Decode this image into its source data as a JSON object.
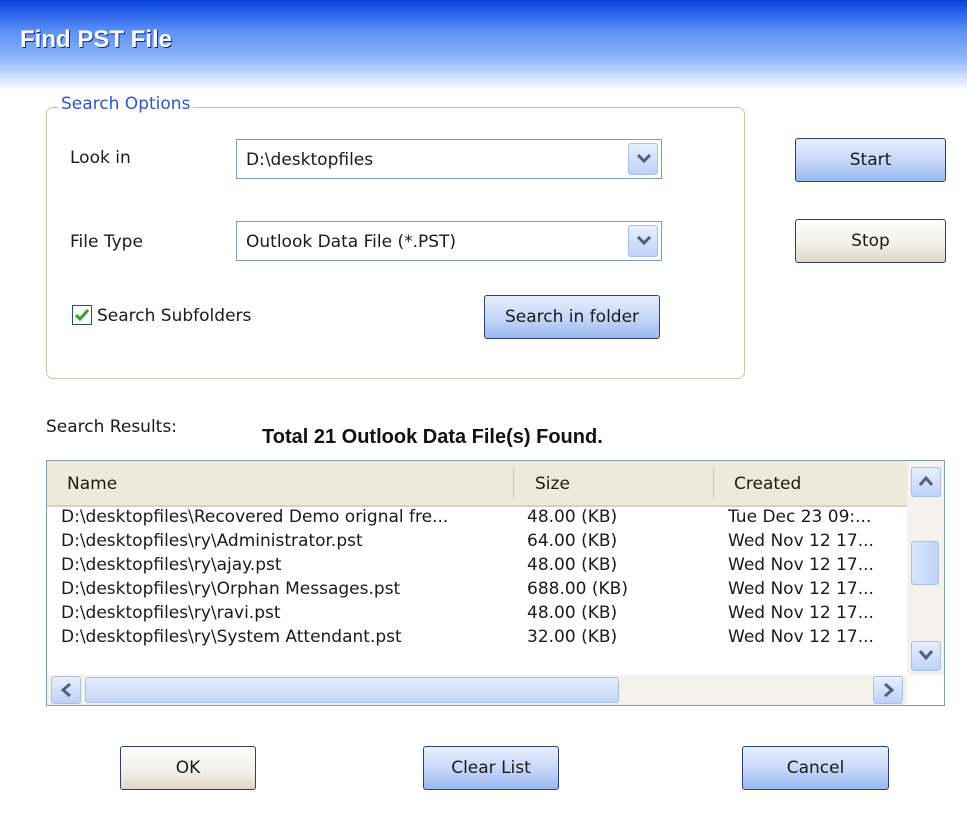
{
  "window": {
    "title": "Find PST File"
  },
  "search_options": {
    "legend": "Search Options",
    "look_in_label": "Look in",
    "look_in_value": "D:\\desktopfiles",
    "file_type_label": "File Type",
    "file_type_value": "Outlook Data File (*.PST)",
    "subfolders_label": "Search Subfolders",
    "subfolders_checked": true,
    "search_folder_button": "Search in folder"
  },
  "actions": {
    "start": "Start",
    "stop": "Stop"
  },
  "results": {
    "label": "Search Results:",
    "summary": "Total 21 Outlook Data File(s) Found.",
    "columns": [
      "Name",
      "Size",
      "Created"
    ],
    "rows": [
      {
        "name": "D:\\desktopfiles\\Recovered Demo orignal fre...",
        "size": "48.00 (KB)",
        "created": "Tue Dec 23 09:..."
      },
      {
        "name": "D:\\desktopfiles\\ry\\Administrator.pst",
        "size": "64.00 (KB)",
        "created": "Wed Nov 12 17..."
      },
      {
        "name": "D:\\desktopfiles\\ry\\ajay.pst",
        "size": "48.00 (KB)",
        "created": "Wed Nov 12 17..."
      },
      {
        "name": "D:\\desktopfiles\\ry\\Orphan Messages.pst",
        "size": "688.00 (KB)",
        "created": "Wed Nov 12 17..."
      },
      {
        "name": "D:\\desktopfiles\\ry\\ravi.pst",
        "size": "48.00 (KB)",
        "created": "Wed Nov 12 17..."
      },
      {
        "name": "D:\\desktopfiles\\ry\\System Attendant.pst",
        "size": "32.00 (KB)",
        "created": "Wed Nov 12 17..."
      }
    ]
  },
  "footer": {
    "ok": "OK",
    "clear_list": "Clear List",
    "cancel": "Cancel"
  },
  "icons": {
    "dropdown": "chevron-down-icon",
    "checkbox": "checkmark-icon",
    "scroll_up": "arrow-up-icon",
    "scroll_down": "arrow-down-icon",
    "scroll_left": "arrow-left-icon",
    "scroll_right": "arrow-right-icon"
  },
  "colors": {
    "title_bar": "#0a3fd6",
    "legend_text": "#2a58c8",
    "checkmark": "#2aa52a",
    "icon_blue": "#4d6185"
  }
}
